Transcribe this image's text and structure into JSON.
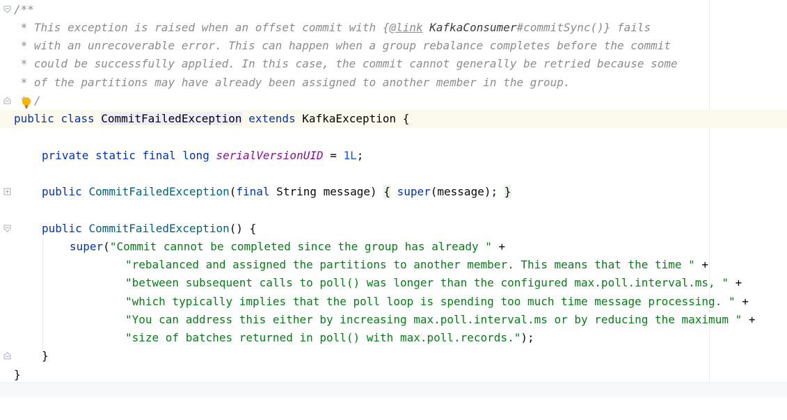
{
  "editor": {
    "comment": {
      "open": "/**",
      "l1_a": " * This exception is raised when an offset commit with ",
      "l1_brace_open": "{",
      "l1_tag": "@link",
      "l1_space": " ",
      "l1_ref_cls": "KafkaConsumer",
      "l1_ref_method": "#commitSync()",
      "l1_brace_close": "}",
      "l1_b": " fails",
      "l2": " * with an unrecoverable error. This can happen when a group rebalance completes before the commit",
      "l3": " * could be successfully applied. In this case, the commit cannot generally be retried because some",
      "l4": " * of the partitions may have already been assigned to another member in the group.",
      "close_a": " *",
      "close_b": "/"
    },
    "class_decl": {
      "kw1": "public",
      "kw2": "class",
      "name": "CommitFailedException",
      "kw3": "extends",
      "parent": "KafkaException",
      "brace": "{"
    },
    "field": {
      "mods": "private static final long",
      "name": "serialVersionUID",
      "eq": " = ",
      "value": "1L",
      "semi": ";"
    },
    "ctor1": {
      "kw": "public",
      "name": "CommitFailedException",
      "paren_open": "(",
      "param_kw": "final",
      "param": " String message)",
      "space": " ",
      "brace_open": "{",
      "sp2": " ",
      "super_kw": "super",
      "call": "(message);",
      "sp3": " ",
      "brace_close": "}"
    },
    "ctor2": {
      "kw": "public",
      "name": "CommitFailedException",
      "sig": "() {",
      "super_kw": "super",
      "paren": "(",
      "s1": "\"Commit cannot be completed since the group has already \"",
      "s2": "\"rebalanced and assigned the partitions to another member. This means that the time \"",
      "s3": "\"between subsequent calls to poll() was longer than the configured max.poll.interval.ms, \"",
      "s4": "\"which typically implies that the poll loop is spending too much time message processing. \"",
      "s5": "\"You can address this either by increasing max.poll.interval.ms or by reducing the maximum \"",
      "s6": "\"size of batches returned in poll() with max.poll.records.\"",
      "plus": " +",
      "end": ");",
      "close": "}"
    },
    "class_close": "}"
  }
}
